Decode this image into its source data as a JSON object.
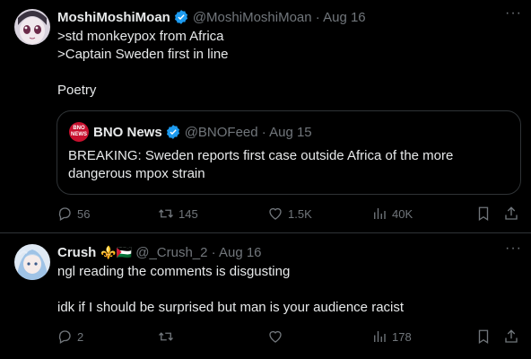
{
  "tweets": [
    {
      "author_name": "MoshiMoshiMoan",
      "handle_date": "@MoshiMoshiMoan · Aug 16",
      "text": ">std monkeypox from Africa\n>Captain Sweden first in line\n\nPoetry",
      "quote": {
        "logo_text": "BNO NEWS",
        "author_name": "BNO News",
        "handle_date": "@BNOFeed · Aug 15",
        "text": "BREAKING: Sweden reports first case outside Africa of the more dangerous mpox strain"
      },
      "actions": {
        "replies": "56",
        "reposts": "145",
        "likes": "1.5K",
        "views": "40K"
      }
    },
    {
      "author_name": "Crush",
      "author_emoji": "⚜️🇵🇸",
      "handle_date": "@_Crush_2 · Aug 16",
      "text": "ngl reading the comments is disgusting\n\nidk if I should be surprised but man is your audience racist",
      "actions": {
        "replies": "2",
        "reposts": "",
        "likes": "",
        "views": "178"
      }
    }
  ],
  "colors": {
    "background": "#000000",
    "text": "#e7e9ea",
    "muted": "#71767b",
    "border": "#2f3336",
    "verified": "#1d9bf0",
    "quote_verified": "#1d9bf0"
  }
}
